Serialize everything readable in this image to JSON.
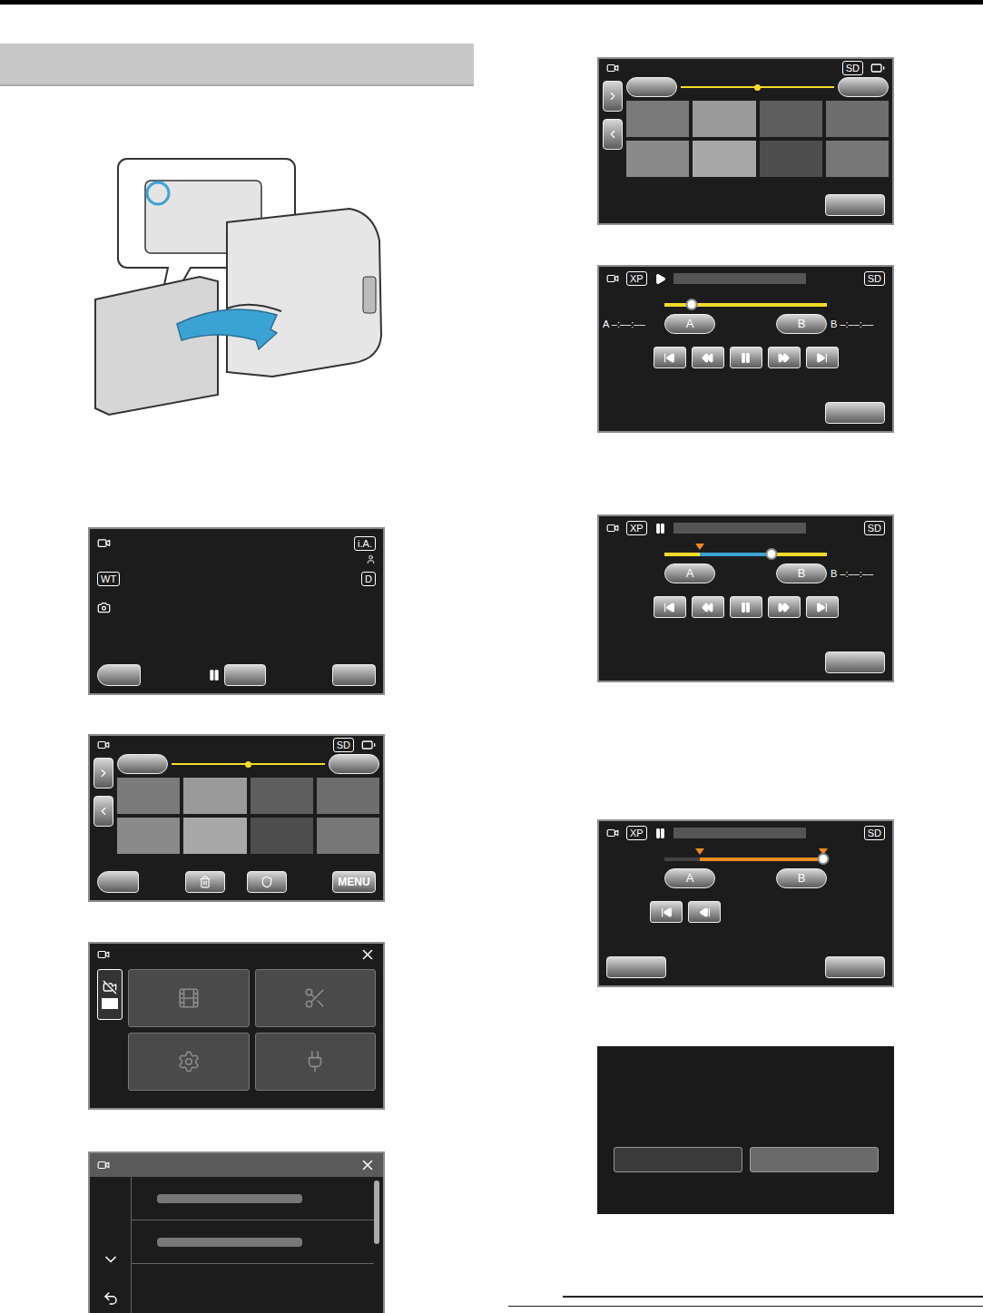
{
  "page": {
    "heading_shaded": true
  },
  "illustration": {
    "highlight_color": "#3ba3d4"
  },
  "screens": [
    {
      "kind": "record",
      "column": "left",
      "labels": {
        "ia": "i.A.",
        "wt": "WT",
        "d": "D"
      }
    },
    {
      "kind": "index",
      "column": "left",
      "storage": "SD",
      "full_toolbar": true,
      "menu_label": "MENU"
    },
    {
      "kind": "menu",
      "column": "left",
      "tiles": [
        "film",
        "scissors",
        "gear",
        "plug"
      ]
    },
    {
      "kind": "list",
      "column": "left",
      "rows": 2
    },
    {
      "kind": "index",
      "column": "right",
      "storage": "SD",
      "full_toolbar": false,
      "menu_label": ""
    },
    {
      "kind": "playback",
      "column": "right",
      "quality": "XP",
      "storage": "SD",
      "paused": false,
      "level": 0.17,
      "a_mark": -1,
      "b_mark": -1,
      "track_color": "#f2dc2a",
      "segment_color": "#f2dc2a",
      "a_button": "A",
      "b_button": "B",
      "a_prefix": "A",
      "b_prefix": "B",
      "a_time": "–:––:––",
      "b_time": "–:––:––",
      "show_a_time": true,
      "show_b_time": true,
      "controls": [
        "skip-back",
        "rewind",
        "pause",
        "fast-forward",
        "skip-forward"
      ],
      "left_button": false
    },
    {
      "kind": "playback",
      "column": "right",
      "quality": "XP",
      "storage": "SD",
      "paused": true,
      "level": 0.66,
      "a_mark": 0.22,
      "b_mark": -1,
      "track_color": "#f2dc2a",
      "segment_color": "#3ba3d4",
      "a_button": "A",
      "b_button": "B",
      "a_prefix": "A",
      "b_prefix": "B",
      "a_time": "–:––:––",
      "b_time": "–:––:––",
      "show_a_time": false,
      "show_b_time": true,
      "controls": [
        "skip-back",
        "rewind",
        "pause",
        "fast-forward",
        "skip-forward"
      ],
      "left_button": false
    },
    {
      "kind": "playback",
      "column": "right",
      "quality": "XP",
      "storage": "SD",
      "paused": true,
      "level": 0.98,
      "a_mark": 0.22,
      "b_mark": 0.98,
      "track_color": "#444444",
      "segment_color": "#f08a1e",
      "a_button": "A",
      "b_button": "B",
      "a_prefix": "A",
      "b_prefix": "B",
      "a_time": "–:––:––",
      "b_time": "–:––:––",
      "show_a_time": false,
      "show_b_time": false,
      "controls": [
        "skip-back",
        "frame-back"
      ],
      "left_button": true
    },
    {
      "kind": "dialog",
      "column": "right",
      "buttons": [
        {
          "selected": false
        },
        {
          "selected": true
        }
      ]
    }
  ]
}
